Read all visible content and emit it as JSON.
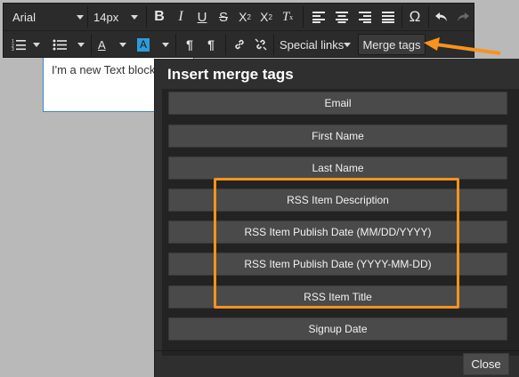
{
  "editor": {
    "text_block": "I'm a new Text block"
  },
  "toolbar": {
    "font_family": "Arial",
    "font_size": "14px",
    "special_links_label": "Special links",
    "merge_tags_label": "Merge tags",
    "icons": [
      "bold-icon",
      "italic-icon",
      "underline-icon",
      "strikethrough-icon",
      "superscript-icon",
      "subscript-icon",
      "clear-formatting-icon",
      "align-left-icon",
      "align-center-icon",
      "align-right-icon",
      "align-justify-icon",
      "special-character-icon",
      "undo-icon",
      "redo-icon",
      "numbered-list-icon",
      "bullet-list-icon",
      "text-color-icon",
      "background-color-icon",
      "ltr-icon",
      "rtl-icon",
      "link-icon",
      "unlink-icon"
    ]
  },
  "dialog": {
    "title": "Insert merge tags",
    "tags": [
      "Email",
      "First Name",
      "Last Name",
      "RSS Item Description",
      "RSS Item Publish Date (MM/DD/YYYY)",
      "RSS Item Publish Date (YYYY-MM-DD)",
      "RSS Item Title",
      "Signup Date"
    ],
    "close_label": "Close"
  },
  "annotation": {
    "highlight_color": "#f7931e"
  }
}
